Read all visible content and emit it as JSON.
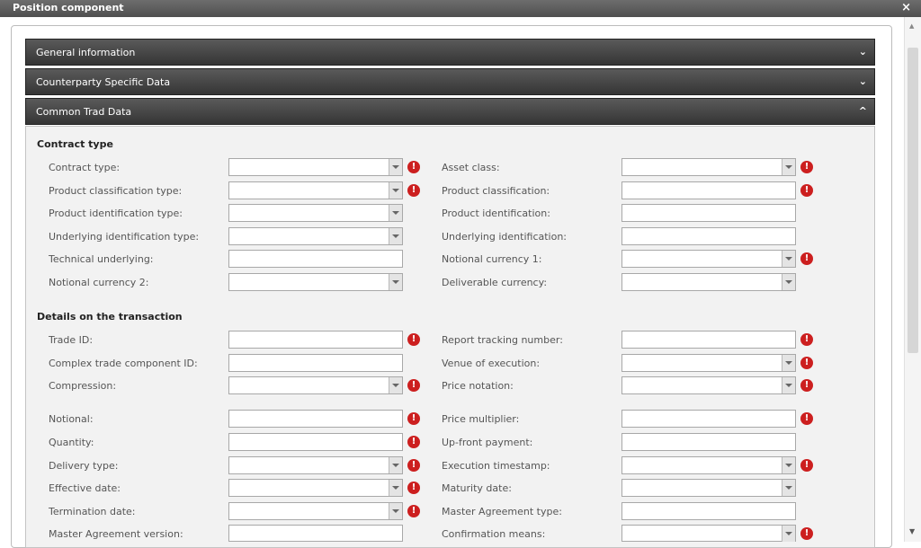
{
  "window": {
    "title": "Position component",
    "close_glyph": "×"
  },
  "accordion": [
    {
      "label": "General information",
      "chevron": "⌄",
      "expanded": false
    },
    {
      "label": "Counterparty Specific Data",
      "chevron": "⌄",
      "expanded": false
    },
    {
      "label": "Common Trad Data",
      "chevron": "^",
      "expanded": true
    }
  ],
  "sections": {
    "contract_type": "Contract type",
    "details": "Details on the transaction"
  },
  "required_icon": "!",
  "fields": {
    "contract_type": "Contract type:",
    "asset_class": "Asset class:",
    "product_classification_type": "Product classification type:",
    "product_classification": "Product classification:",
    "product_identification_type": "Product identification type:",
    "product_identification": "Product identification:",
    "underlying_identification_type": "Underlying identification type:",
    "underlying_identification": "Underlying identification:",
    "technical_underlying": "Technical underlying:",
    "notional_currency_1": "Notional currency 1:",
    "notional_currency_2": "Notional currency 2:",
    "deliverable_currency": "Deliverable currency:",
    "trade_id": "Trade ID:",
    "report_tracking_number": "Report tracking number:",
    "complex_trade_component_id": "Complex trade component ID:",
    "venue_of_execution": "Venue of execution:",
    "compression": "Compression:",
    "price_notation": "Price notation:",
    "notional": "Notional:",
    "price_multiplier": "Price multiplier:",
    "quantity": "Quantity:",
    "up_front_payment": "Up-front payment:",
    "delivery_type": "Delivery type:",
    "execution_timestamp": "Execution timestamp:",
    "effective_date": "Effective date:",
    "maturity_date": "Maturity date:",
    "termination_date": "Termination date:",
    "master_agreement_type": "Master Agreement type:",
    "master_agreement_version": "Master Agreement version:",
    "confirmation_means": "Confirmation means:"
  },
  "colors": {
    "header_dark": "#3f3f3f",
    "required_red": "#cc1f1f",
    "panel_bg": "#f2f2f2"
  }
}
